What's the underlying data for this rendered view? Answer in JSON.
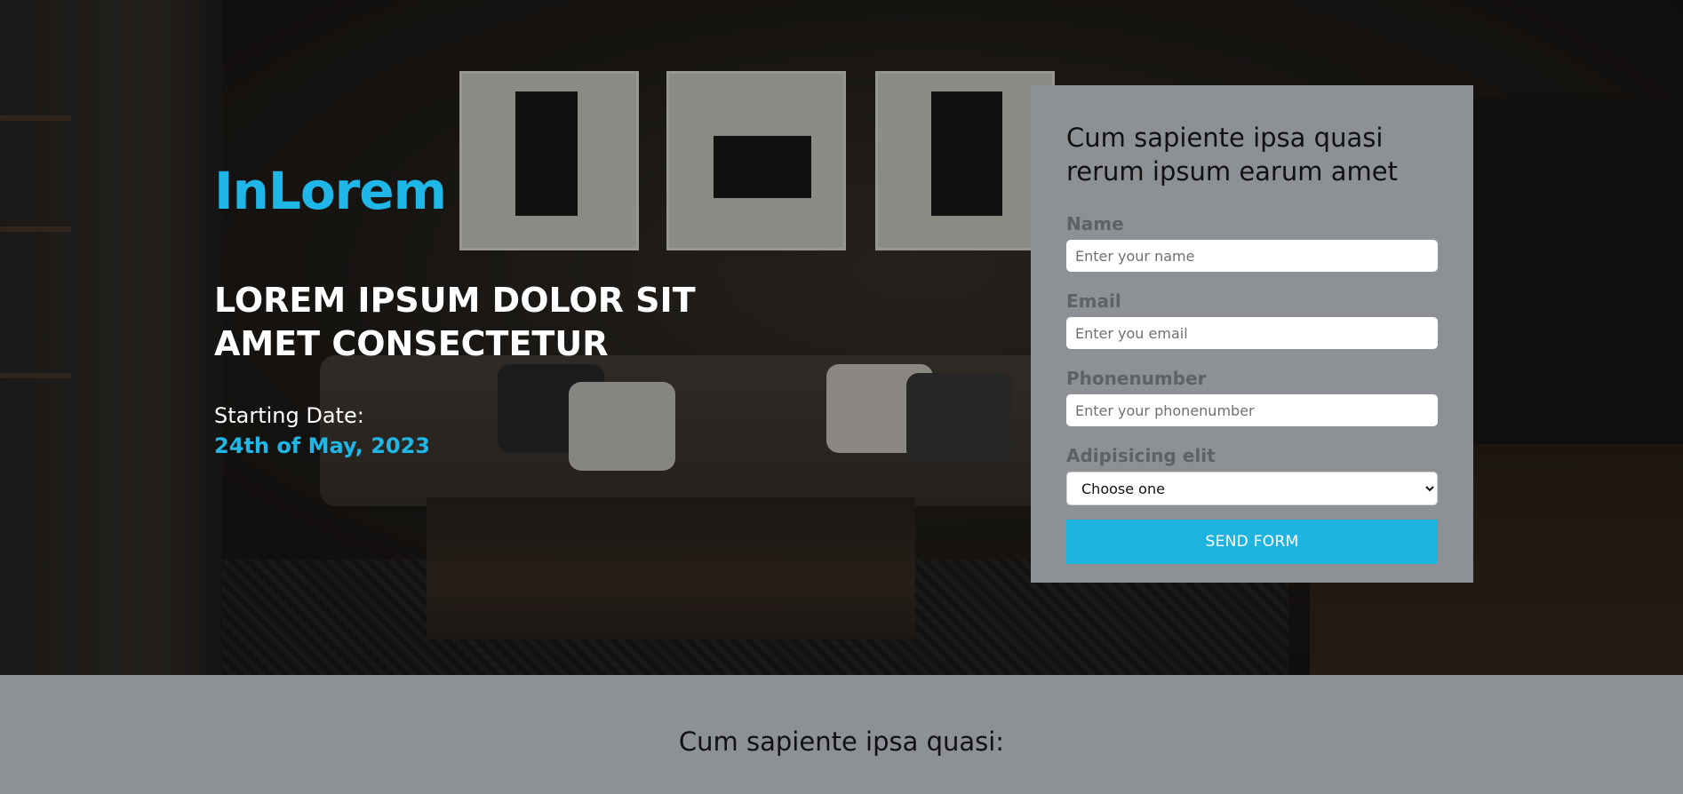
{
  "hero": {
    "brand": "InLorem",
    "headline": "LOREM IPSUM DOLOR SIT AMET CONSECTETUR",
    "date_label": "Starting Date:",
    "date_value": "24th of May, 2023"
  },
  "form": {
    "title": "Cum sapiente ipsa quasi rerum ipsum earum amet",
    "name_label": "Name",
    "name_placeholder": "Enter your name",
    "email_label": "Email",
    "email_placeholder": "Enter you email",
    "phone_label": "Phonenumber",
    "phone_placeholder": "Enter your phonenumber",
    "select_label": "Adipisicing elit",
    "select_value": "Choose one",
    "submit_label": "SEND FORM"
  },
  "section": {
    "title": "Cum sapiente ipsa quasi:"
  },
  "colors": {
    "accent": "#1fb7e8",
    "panel": "#8d9094",
    "button": "#1fb3e0"
  }
}
